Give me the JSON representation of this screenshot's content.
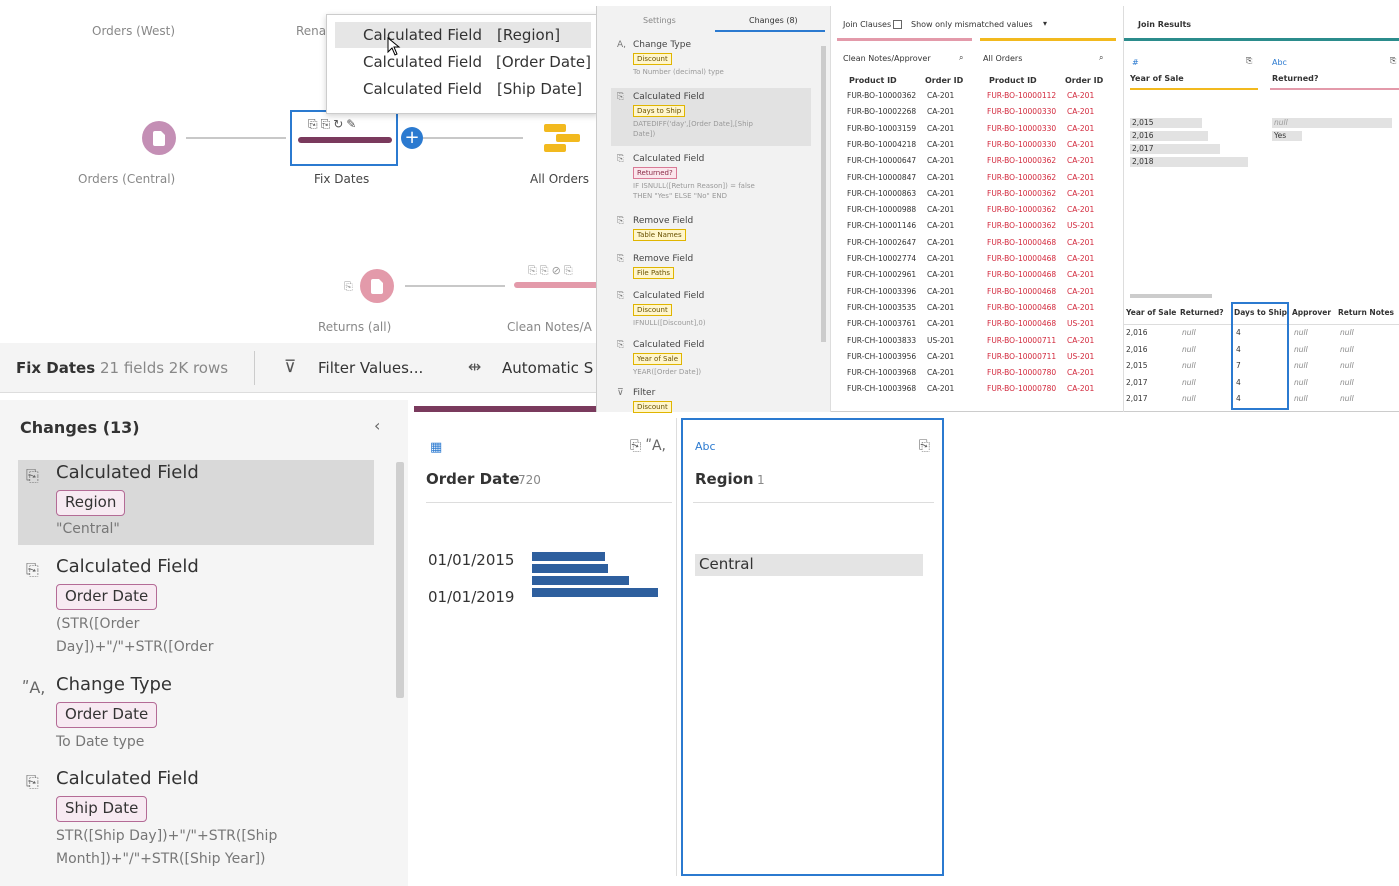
{
  "flow": {
    "nodes": [
      {
        "label": "Orders (West)"
      },
      {
        "label": "Rena"
      },
      {
        "label": "Orders (Central)"
      },
      {
        "label": "Fix Dates"
      },
      {
        "label": "All Orders"
      },
      {
        "label": "Returns (all)"
      },
      {
        "label": "Clean Notes/A"
      }
    ]
  },
  "popup": {
    "items": [
      {
        "label": "Calculated Field",
        "field": "[Region]"
      },
      {
        "label": "Calculated Field",
        "field": "[Order Date]"
      },
      {
        "label": "Calculated Field",
        "field": "[Ship Date]"
      }
    ]
  },
  "toolbar": {
    "step_name": "Fix Dates",
    "stats": "21 fields  2K rows",
    "filter_label": "Filter Values...",
    "split_label": "Automatic S"
  },
  "changes": {
    "header": "Changes (13)",
    "items": [
      {
        "title": "Calculated Field",
        "pill": "Region",
        "desc1": "\"Central\"",
        "desc2": ""
      },
      {
        "title": "Calculated Field",
        "pill": "Order Date",
        "desc1": "(STR([Order",
        "desc2": "Day])+\"/\"+STR([Order"
      },
      {
        "title": "Change Type",
        "pill": "Order Date",
        "desc1": "To Date type",
        "desc2": ""
      },
      {
        "title": "Calculated Field",
        "pill": "Ship Date",
        "desc1": "STR([Ship Day])+\"/\"+STR([Ship",
        "desc2": "Month])+\"/\"+STR([Ship Year])"
      }
    ]
  },
  "profile": {
    "order_date": {
      "name": "Order Date",
      "count": "720",
      "labels": [
        "01/01/2015",
        "01/01/2019"
      ],
      "bars": [
        0.52,
        0.54,
        0.69,
        0.9
      ]
    },
    "region": {
      "type": "Abc",
      "name": "Region",
      "count": "1",
      "value": "Central"
    }
  },
  "composite": {
    "tabs": [
      "Settings",
      "Changes (8)"
    ],
    "changes": [
      {
        "title": "Change Type",
        "pill": "Discount",
        "desc": [
          "To Number (decimal) type"
        ],
        "pill_color": "yellow"
      },
      {
        "title": "Calculated Field",
        "pill": "Days to Ship",
        "desc": [
          "DATEDIFF('day',[Order Date],[Ship",
          "Date])"
        ],
        "pill_color": "yellow"
      },
      {
        "title": "Calculated Field",
        "pill": "Returned?",
        "desc": [
          "IF ISNULL([Return Reason]) = false",
          "THEN \"Yes\" ELSE \"No\" END"
        ],
        "pill_color": "pink"
      },
      {
        "title": "Remove Field",
        "pill": "Table Names",
        "desc": [],
        "pill_color": "yellow"
      },
      {
        "title": "Remove Field",
        "pill": "File Paths",
        "desc": [],
        "pill_color": "yellow"
      },
      {
        "title": "Calculated Field",
        "pill": "Discount",
        "desc": [
          "IFNULL([Discount],0)"
        ],
        "pill_color": "yellow"
      },
      {
        "title": "Calculated Field",
        "pill": "Year of Sale",
        "desc": [
          "YEAR([Order Date])"
        ],
        "pill_color": "yellow"
      },
      {
        "title": "Filter",
        "pill": "Discount",
        "desc": [],
        "pill_color": "yellow"
      }
    ],
    "join": {
      "clauses_label": "Join Clauses",
      "mismatch_label": "Show only mismatched values",
      "left_table": "Clean Notes/Approver",
      "right_table": "All Orders",
      "col1": "Product ID",
      "col2": "Order ID",
      "left_rows": [
        [
          "FUR-BO-10000362",
          "CA-201"
        ],
        [
          "FUR-BO-10002268",
          "CA-201"
        ],
        [
          "FUR-BO-10003159",
          "CA-201"
        ],
        [
          "FUR-BO-10004218",
          "CA-201"
        ],
        [
          "FUR-CH-10000647",
          "CA-201"
        ],
        [
          "FUR-CH-10000847",
          "CA-201"
        ],
        [
          "FUR-CH-10000863",
          "CA-201"
        ],
        [
          "FUR-CH-10000988",
          "CA-201"
        ],
        [
          "FUR-CH-10001146",
          "CA-201"
        ],
        [
          "FUR-CH-10002647",
          "CA-201"
        ],
        [
          "FUR-CH-10002774",
          "CA-201"
        ],
        [
          "FUR-CH-10002961",
          "CA-201"
        ],
        [
          "FUR-CH-10003396",
          "CA-201"
        ],
        [
          "FUR-CH-10003535",
          "CA-201"
        ],
        [
          "FUR-CH-10003761",
          "CA-201"
        ],
        [
          "FUR-CH-10003833",
          "US-201"
        ],
        [
          "FUR-CH-10003956",
          "CA-201"
        ],
        [
          "FUR-CH-10003968",
          "CA-201"
        ],
        [
          "FUR-CH-10003968",
          "CA-201"
        ]
      ],
      "right_rows": [
        [
          "FUR-BO-10000112",
          "CA-201"
        ],
        [
          "FUR-BO-10000330",
          "CA-201"
        ],
        [
          "FUR-BO-10000330",
          "CA-201"
        ],
        [
          "FUR-BO-10000330",
          "CA-201"
        ],
        [
          "FUR-BO-10000362",
          "CA-201"
        ],
        [
          "FUR-BO-10000362",
          "CA-201"
        ],
        [
          "FUR-BO-10000362",
          "CA-201"
        ],
        [
          "FUR-BO-10000362",
          "CA-201"
        ],
        [
          "FUR-BO-10000362",
          "US-201"
        ],
        [
          "FUR-BO-10000468",
          "CA-201"
        ],
        [
          "FUR-BO-10000468",
          "CA-201"
        ],
        [
          "FUR-BO-10000468",
          "CA-201"
        ],
        [
          "FUR-BO-10000468",
          "CA-201"
        ],
        [
          "FUR-BO-10000468",
          "CA-201"
        ],
        [
          "FUR-BO-10000468",
          "US-201"
        ],
        [
          "FUR-BO-10000711",
          "CA-201"
        ],
        [
          "FUR-BO-10000711",
          "US-201"
        ],
        [
          "FUR-BO-10000780",
          "CA-201"
        ],
        [
          "FUR-BO-10000780",
          "CA-201"
        ]
      ]
    },
    "results": {
      "title": "Join Results",
      "year_label": "Year of Sale",
      "returned_label": "Returned?",
      "years": [
        "2,015",
        "2,016",
        "2,017",
        "2,018"
      ],
      "returned_values": [
        "null",
        "Yes"
      ],
      "grid_headers": [
        "Year of Sale",
        "Returned?",
        "Days to Ship",
        "Approver",
        "Return Notes"
      ],
      "grid_rows": [
        [
          "2,016",
          "null",
          "4",
          "null",
          "null"
        ],
        [
          "2,016",
          "null",
          "4",
          "null",
          "null"
        ],
        [
          "2,015",
          "null",
          "7",
          "null",
          "null"
        ],
        [
          "2,017",
          "null",
          "4",
          "null",
          "null"
        ],
        [
          "2,017",
          "null",
          "4",
          "null",
          "null"
        ]
      ]
    }
  },
  "colors": {
    "accent_blue": "#2b7ad0",
    "input_purple": "#c48fb5",
    "returns_pink": "#e39aaa",
    "step_bar": "#7a3a5d",
    "join_yellow": "#f2b91e",
    "histogram": "#2e5f9e"
  }
}
